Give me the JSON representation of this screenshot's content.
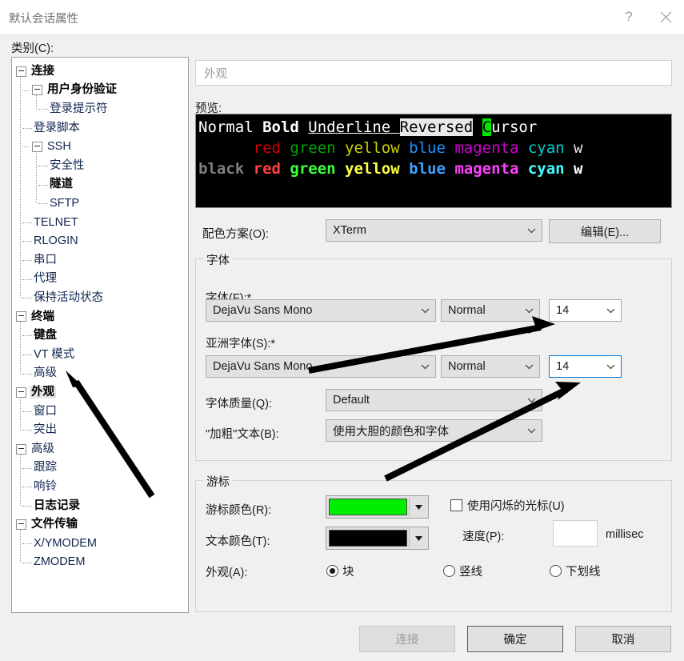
{
  "window": {
    "title": "默认会话属性",
    "help_icon": "question-mark-icon",
    "help_label": "?",
    "close_icon": "close-icon"
  },
  "sidebar": {
    "label": "类别(C):",
    "items": [
      {
        "label": "连接",
        "depth": 0,
        "bold": true,
        "expander": true,
        "selected": false
      },
      {
        "label": "用户身份验证",
        "depth": 1,
        "bold": true,
        "expander": true,
        "selected": false
      },
      {
        "label": "登录提示符",
        "depth": 2,
        "bold": false,
        "expander": false,
        "selected": false
      },
      {
        "label": "登录脚本",
        "depth": 1,
        "bold": false,
        "expander": false,
        "selected": false
      },
      {
        "label": "SSH",
        "depth": 1,
        "bold": false,
        "expander": true,
        "selected": false
      },
      {
        "label": "安全性",
        "depth": 2,
        "bold": false,
        "expander": false,
        "selected": false
      },
      {
        "label": "隧道",
        "depth": 2,
        "bold": true,
        "expander": false,
        "selected": false
      },
      {
        "label": "SFTP",
        "depth": 2,
        "bold": false,
        "expander": false,
        "selected": false
      },
      {
        "label": "TELNET",
        "depth": 1,
        "bold": false,
        "expander": false,
        "selected": false
      },
      {
        "label": "RLOGIN",
        "depth": 1,
        "bold": false,
        "expander": false,
        "selected": false
      },
      {
        "label": "串口",
        "depth": 1,
        "bold": false,
        "expander": false,
        "selected": false
      },
      {
        "label": "代理",
        "depth": 1,
        "bold": false,
        "expander": false,
        "selected": false
      },
      {
        "label": "保持活动状态",
        "depth": 1,
        "bold": false,
        "expander": false,
        "selected": false
      },
      {
        "label": "终端",
        "depth": 0,
        "bold": true,
        "expander": true,
        "selected": false
      },
      {
        "label": "键盘",
        "depth": 1,
        "bold": true,
        "expander": false,
        "selected": false
      },
      {
        "label": "VT 模式",
        "depth": 1,
        "bold": false,
        "expander": false,
        "selected": false
      },
      {
        "label": "高级",
        "depth": 1,
        "bold": false,
        "expander": false,
        "selected": false
      },
      {
        "label": "外观",
        "depth": 0,
        "bold": true,
        "expander": true,
        "selected": true
      },
      {
        "label": "窗口",
        "depth": 1,
        "bold": false,
        "expander": false,
        "selected": false
      },
      {
        "label": "突出",
        "depth": 1,
        "bold": false,
        "expander": false,
        "selected": false
      },
      {
        "label": "高级",
        "depth": 0,
        "bold": false,
        "expander": true,
        "selected": false
      },
      {
        "label": "跟踪",
        "depth": 1,
        "bold": false,
        "expander": false,
        "selected": false
      },
      {
        "label": "响铃",
        "depth": 1,
        "bold": false,
        "expander": false,
        "selected": false
      },
      {
        "label": "日志记录",
        "depth": 1,
        "bold": true,
        "expander": false,
        "selected": false
      },
      {
        "label": "文件传输",
        "depth": 0,
        "bold": true,
        "expander": true,
        "selected": false
      },
      {
        "label": "X/YMODEM",
        "depth": 1,
        "bold": false,
        "expander": false,
        "selected": false
      },
      {
        "label": "ZMODEM",
        "depth": 1,
        "bold": false,
        "expander": false,
        "selected": false
      }
    ]
  },
  "page": {
    "header": "外观",
    "preview_label": "预览:",
    "preview": {
      "row1": [
        {
          "text": "Normal ",
          "style": "normal",
          "color": "#ffffff"
        },
        {
          "text": "Bold ",
          "style": "bold",
          "color": "#ffffff"
        },
        {
          "text": "Underline ",
          "style": "underline",
          "color": "#ffffff"
        },
        {
          "text": "Reversed",
          "style": "reversed",
          "color": "#000000",
          "bg": "#e8e8e8"
        },
        {
          "text": " ",
          "style": "normal",
          "color": "#ffffff"
        },
        {
          "text": "C",
          "style": "cursor",
          "color": "#000000",
          "bg": "#00e800"
        },
        {
          "text": "ursor",
          "style": "normal",
          "color": "#ffffff"
        }
      ],
      "row2": [
        {
          "text": "      ",
          "color": "#000000"
        },
        {
          "text": "red ",
          "color": "#cd0000"
        },
        {
          "text": "green ",
          "color": "#00a300"
        },
        {
          "text": "yellow ",
          "color": "#cdcd00"
        },
        {
          "text": "blue ",
          "color": "#1e90ff"
        },
        {
          "text": "magenta ",
          "color": "#cd00cd"
        },
        {
          "text": "cyan ",
          "color": "#00cdcd"
        },
        {
          "text": "w",
          "color": "#e5e5e5"
        }
      ],
      "row3": [
        {
          "text": "black ",
          "color": "#7f7f7f"
        },
        {
          "text": "red ",
          "color": "#ff4040"
        },
        {
          "text": "green ",
          "color": "#40ff40"
        },
        {
          "text": "yellow ",
          "color": "#ffff40"
        },
        {
          "text": "blue ",
          "color": "#40a0ff"
        },
        {
          "text": "magenta ",
          "color": "#ff40ff"
        },
        {
          "text": "cyan ",
          "color": "#40ffff"
        },
        {
          "text": "w",
          "color": "#ffffff"
        }
      ]
    },
    "color_scheme": {
      "label": "配色方案(O):",
      "value": "XTerm",
      "edit_button": "编辑(E)..."
    },
    "font_group": {
      "title": "字体",
      "font_label": "字体(F):*",
      "font_family": "DejaVu Sans Mono",
      "font_style": "Normal",
      "font_size": "14",
      "asian_label": "亚洲字体(S):*",
      "asian_family": "DejaVu Sans Mono",
      "asian_style": "Normal",
      "asian_size": "14",
      "quality_label": "字体质量(Q):",
      "quality_value": "Default",
      "bold_label": "\"加粗\"文本(B):",
      "bold_value": "使用大胆的颜色和字体"
    },
    "cursor_group": {
      "title": "游标",
      "cursor_color_label": "游标颜色(R):",
      "cursor_color": "#00ee00",
      "text_color_label": "文本颜色(T):",
      "text_color": "#000000",
      "blink_label": "使用闪烁的光标(U)",
      "blink_checked": false,
      "speed_label": "速度(P):",
      "speed_value": "",
      "speed_unit": "millisec",
      "appearance_label": "外观(A):",
      "radios": [
        {
          "label": "块",
          "selected": true
        },
        {
          "label": "竖线",
          "selected": false
        },
        {
          "label": "下划线",
          "selected": false
        }
      ]
    }
  },
  "footer": {
    "connect": "连接",
    "ok": "确定",
    "cancel": "取消"
  }
}
